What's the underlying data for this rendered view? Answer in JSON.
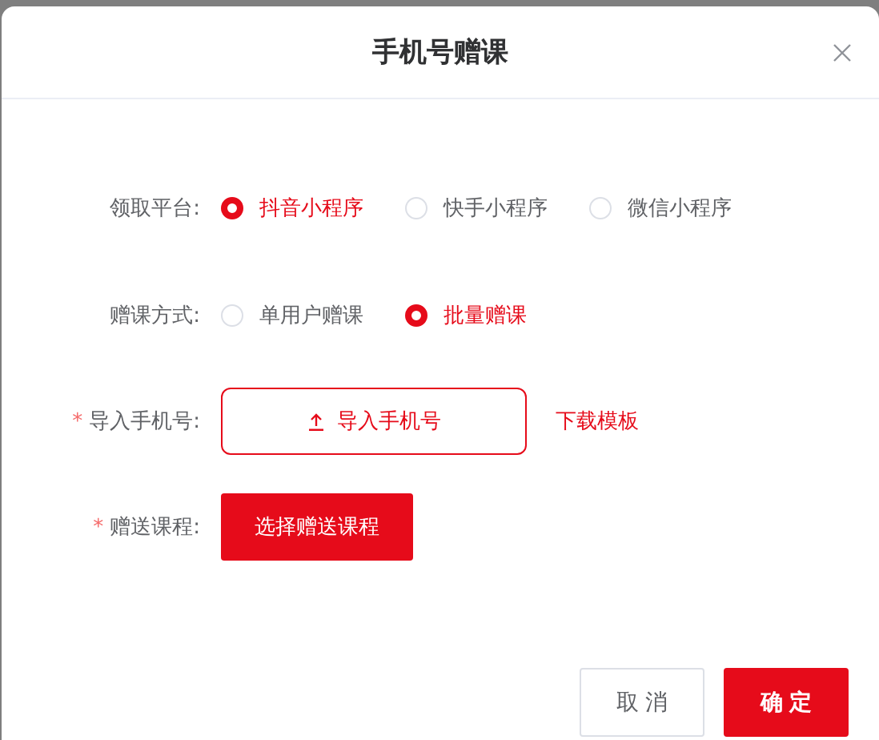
{
  "dialog": {
    "title": "手机号赠课"
  },
  "fields": [
    {
      "kind": "radio",
      "label": "领取平台:",
      "options": [
        {
          "label": "抖音小程序",
          "selected": true
        },
        {
          "label": "快手小程序",
          "selected": false
        },
        {
          "label": "微信小程序",
          "selected": false
        }
      ]
    },
    {
      "kind": "radio",
      "label": "赠课方式:",
      "options": [
        {
          "label": "单用户赠课",
          "selected": false
        },
        {
          "label": "批量赠课",
          "selected": true
        }
      ]
    },
    {
      "kind": "upload",
      "label": "导入手机号:",
      "required_mark": "*",
      "button": "导入手机号",
      "link": "下载模板"
    },
    {
      "kind": "button",
      "label": "赠送课程:",
      "required_mark": "*",
      "button": "选择赠送课程"
    }
  ],
  "buttons": [
    {
      "label": "取消",
      "kind": "default"
    },
    {
      "label": "确定",
      "kind": "primary"
    }
  ]
}
